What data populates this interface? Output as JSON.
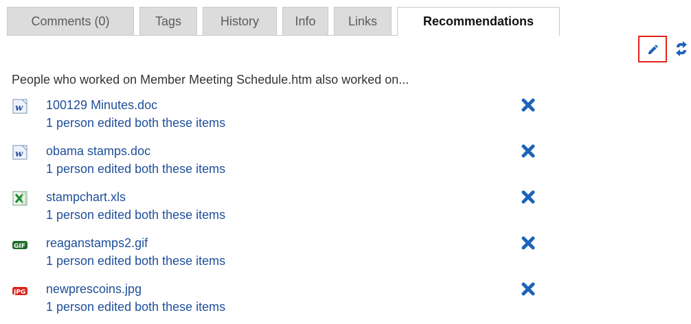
{
  "tabs": [
    {
      "label": "Comments (0)",
      "active": false
    },
    {
      "label": "Tags",
      "active": false
    },
    {
      "label": "History",
      "active": false
    },
    {
      "label": "Info",
      "active": false
    },
    {
      "label": "Links",
      "active": false
    },
    {
      "label": "Recommendations",
      "active": true
    }
  ],
  "toolbar": {
    "edit_icon": "pencil-icon",
    "refresh_icon": "refresh-arrows-icon",
    "highlight_color": "#e2231a"
  },
  "intro": "People who worked on Member Meeting Schedule.htm also worked on...",
  "recommendations": [
    {
      "name": "100129 Minutes.doc",
      "detail": "1 person edited both these items",
      "icon": "word-doc-icon"
    },
    {
      "name": "obama stamps.doc",
      "detail": "1 person edited both these items",
      "icon": "word-doc-icon"
    },
    {
      "name": "stampchart.xls",
      "detail": "1 person edited both these items",
      "icon": "excel-xls-icon"
    },
    {
      "name": "reaganstamps2.gif",
      "detail": "1 person edited both these items",
      "icon": "gif-image-icon"
    },
    {
      "name": "newprescoins.jpg",
      "detail": "1 person edited both these items",
      "icon": "jpg-image-icon"
    }
  ],
  "remove_icon": "remove-x-icon",
  "colors": {
    "link": "#1f4f9a",
    "remove": "#1d63b8",
    "tab_inactive_bg": "#dcdcdc",
    "tab_active_bg": "#ffffff"
  }
}
